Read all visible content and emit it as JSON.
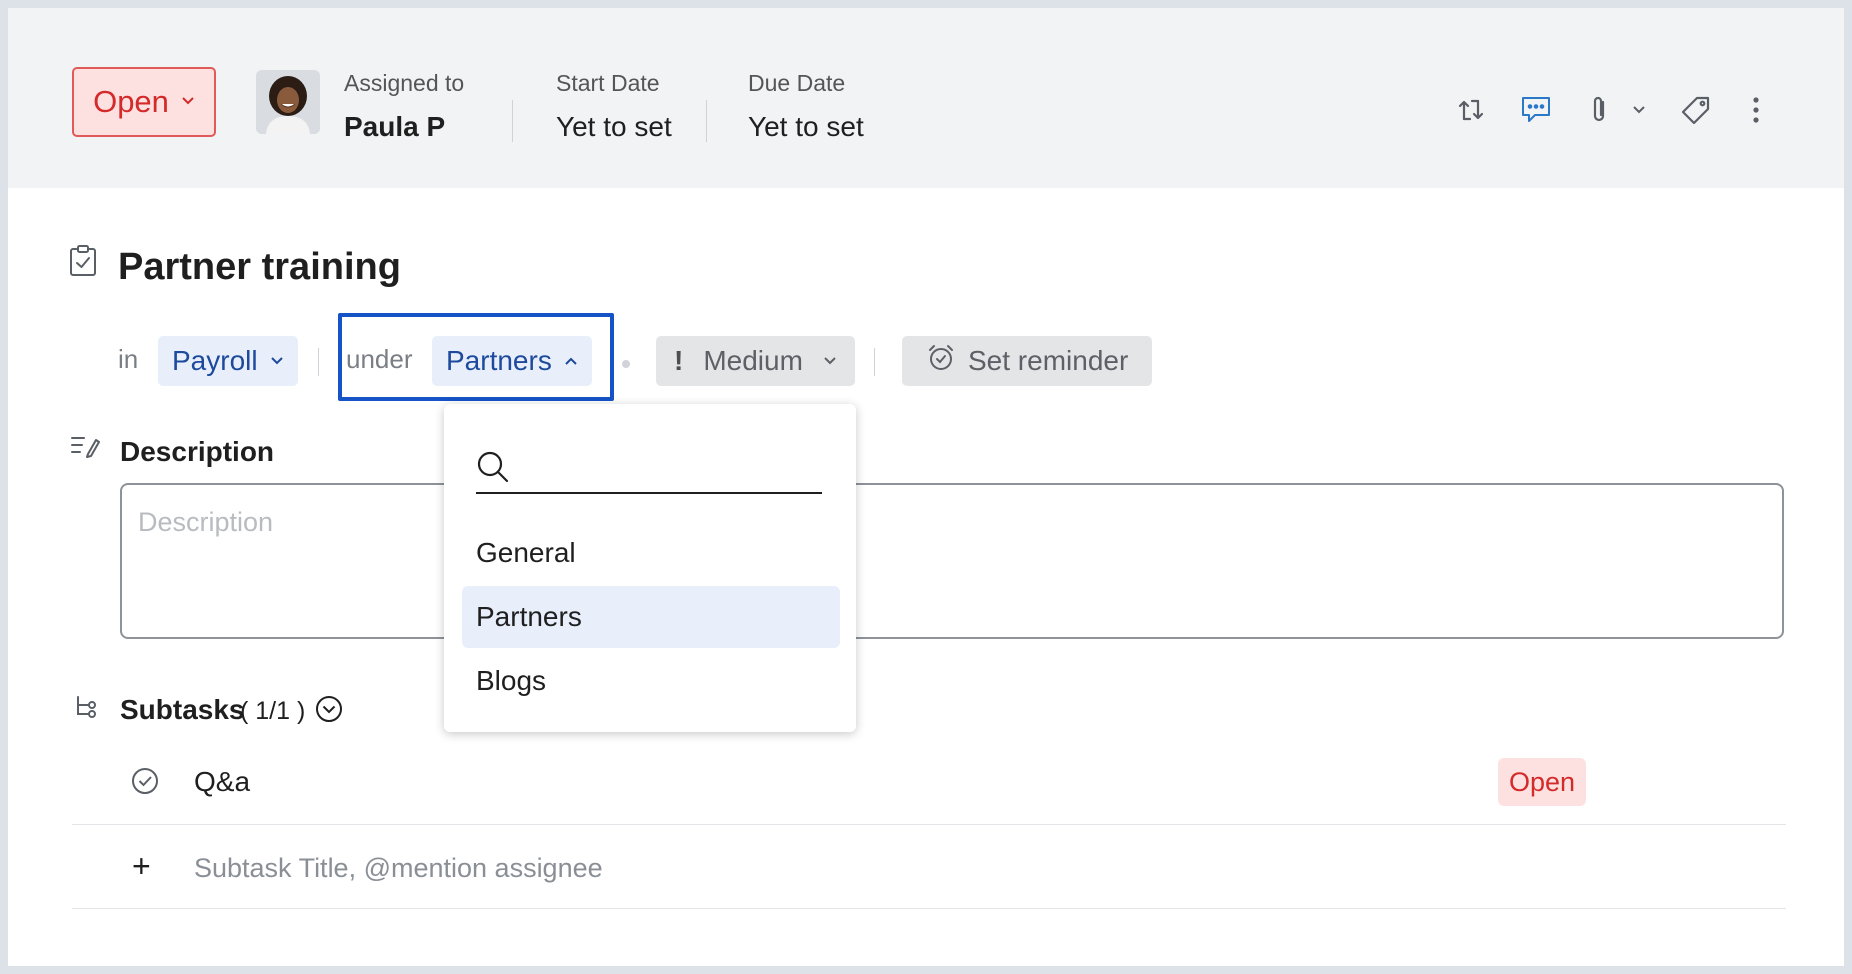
{
  "header": {
    "status_label": "Open",
    "assigned_label": "Assigned to",
    "assigned_value": "Paula P",
    "start_label": "Start Date",
    "start_value": "Yet to set",
    "due_label": "Due Date",
    "due_value": "Yet to set",
    "toolbar_icons": [
      "convert-icon",
      "comment-icon",
      "attachment-icon",
      "tag-icon",
      "more-vertical-icon"
    ]
  },
  "task": {
    "title": "Partner training",
    "in_label": "in",
    "project": "Payroll",
    "under_label": "under",
    "tasklist": "Partners",
    "priority": "Medium",
    "reminder_label": "Set reminder"
  },
  "description": {
    "heading": "Description",
    "placeholder": "Description"
  },
  "subtasks": {
    "heading": "Subtasks",
    "count": "( 1/1 )",
    "items": [
      {
        "title": "Q&a",
        "status": "Open"
      }
    ],
    "add_placeholder": "Subtask Title, @mention assignee",
    "add_symbol": "+"
  },
  "dropdown": {
    "search_placeholder": "",
    "options": [
      "General",
      "Partners",
      "Blogs"
    ],
    "selected": "Partners"
  },
  "colors": {
    "status_red": "#d42a2a",
    "status_bg": "#fde1e1",
    "chip_blue_bg": "#e8effb",
    "chip_blue_text": "#1d4a9c",
    "focus_outline": "#1553c7"
  }
}
